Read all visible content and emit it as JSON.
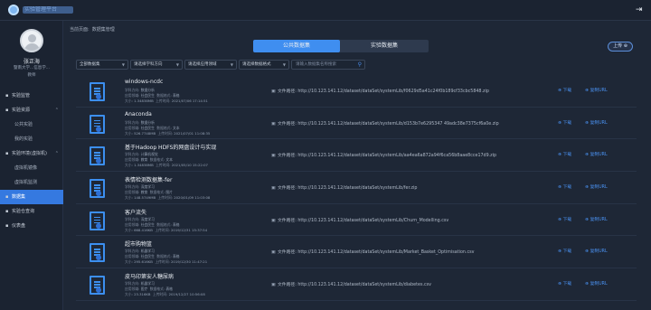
{
  "header": {
    "brand": "实验管理平台",
    "logout_icon": "logout-icon"
  },
  "user": {
    "name": "张正海",
    "dept": "暨南大学...信息学...",
    "role": "教师"
  },
  "nav": [
    {
      "label": "实验监管",
      "icon": "monitor-icon",
      "type": "item"
    },
    {
      "label": "实验资源",
      "icon": "book-icon",
      "type": "group"
    },
    {
      "label": "公共实验",
      "type": "sub"
    },
    {
      "label": "我的实验",
      "type": "sub"
    },
    {
      "label": "实验环境(虚拟机)",
      "icon": "server-icon",
      "type": "group"
    },
    {
      "label": "虚拟机镜像",
      "type": "sub"
    },
    {
      "label": "虚拟机监测",
      "type": "sub"
    },
    {
      "label": "数据集",
      "icon": "database-icon",
      "type": "item",
      "active": true
    },
    {
      "label": "实验仓查询",
      "icon": "search-icon",
      "type": "item"
    },
    {
      "label": "仪表盘",
      "icon": "dashboard-icon",
      "type": "item"
    }
  ],
  "breadcrumb": {
    "current_label": "当前页面:",
    "page": "数据集管理"
  },
  "tabs": {
    "public": "公共数据集",
    "experiment": "实验数据集"
  },
  "upload_label": "上传",
  "filters": {
    "all": "全部数据集",
    "subject": "请选择学科方向",
    "domain": "请选择应用领域",
    "format": "请选择数据格式",
    "search_placeholder": "请输入数据集名称搜索"
  },
  "labels": {
    "subject": "学科方向:",
    "domain": "应用领域:",
    "format": "数据格式:",
    "size": "大小:",
    "time": "上传时间:",
    "path": "文件路径:",
    "download": "下载",
    "copy": "复制URL"
  },
  "datasets": [
    {
      "title": "windows-ncdc",
      "subject": "数据分析",
      "domain": "社会民生",
      "format": "表格",
      "size": "1.34838MB",
      "time": "2021/07/06 17:14:51",
      "path": "http://10.123.141.12/dataset/dataSet/systemLib/f0629d5a41c24f0b189cf33cbc5848.zip"
    },
    {
      "title": "Anaconda",
      "subject": "数据分析",
      "domain": "社会民生",
      "format": "文本",
      "size": "526.7748MB",
      "time": "2021/07/01 11:08:35",
      "path": "http://10.123.141.12/dataset/dataSet/systemLib/d153b7e6295347 49adc38e7375cf6a0e.zip"
    },
    {
      "title": "基于Hadoop HDFS的网盘设计与实现",
      "subject": "计算机视觉",
      "domain": "教育",
      "format": "文本",
      "size": "1.34838MB",
      "time": "2021/05/10 15:22:07",
      "path": "http://10.123.141.12/dataset/dataSet/systemLib/aa4ea6a872a94f6ca56b8aae8cce17d9.zip"
    },
    {
      "title": "表情检测数据集-fer",
      "subject": "深度学习",
      "domain": "教育",
      "format": "图片",
      "size": "148.5749MB",
      "time": "2020/01/09 11:03:08",
      "path": "http://10.123.141.12/dataset/dataSet/systemLib/fer.zip"
    },
    {
      "title": "客户流失",
      "subject": "深度学习",
      "domain": "社会民生",
      "format": "表格",
      "size": "668.416KB",
      "time": "2019/12/31 15:37:54",
      "path": "http://10.123.141.12/dataset/dataSet/systemLib/Churn_Modelling.csv"
    },
    {
      "title": "超市购物篮",
      "subject": "机器学习",
      "domain": "社会民生",
      "format": "表格",
      "size": "295.616KB",
      "time": "2019/12/30 11:47:21",
      "path": "http://10.123.141.12/dataset/dataSet/systemLib/Market_Basket_Optimisation.csv"
    },
    {
      "title": "皮马印第安人糖尿病",
      "subject": "机器学习",
      "domain": "医疗",
      "format": "表格",
      "size": "23.316KB",
      "time": "2019/12/27 10:56:08",
      "path": "http://10.123.141.12/dataset/dataSet/systemLib/diabetes.csv"
    }
  ],
  "colors": {
    "accent": "#3f8ef0",
    "bg": "#1e2736",
    "sidebar": "#1b2331"
  }
}
